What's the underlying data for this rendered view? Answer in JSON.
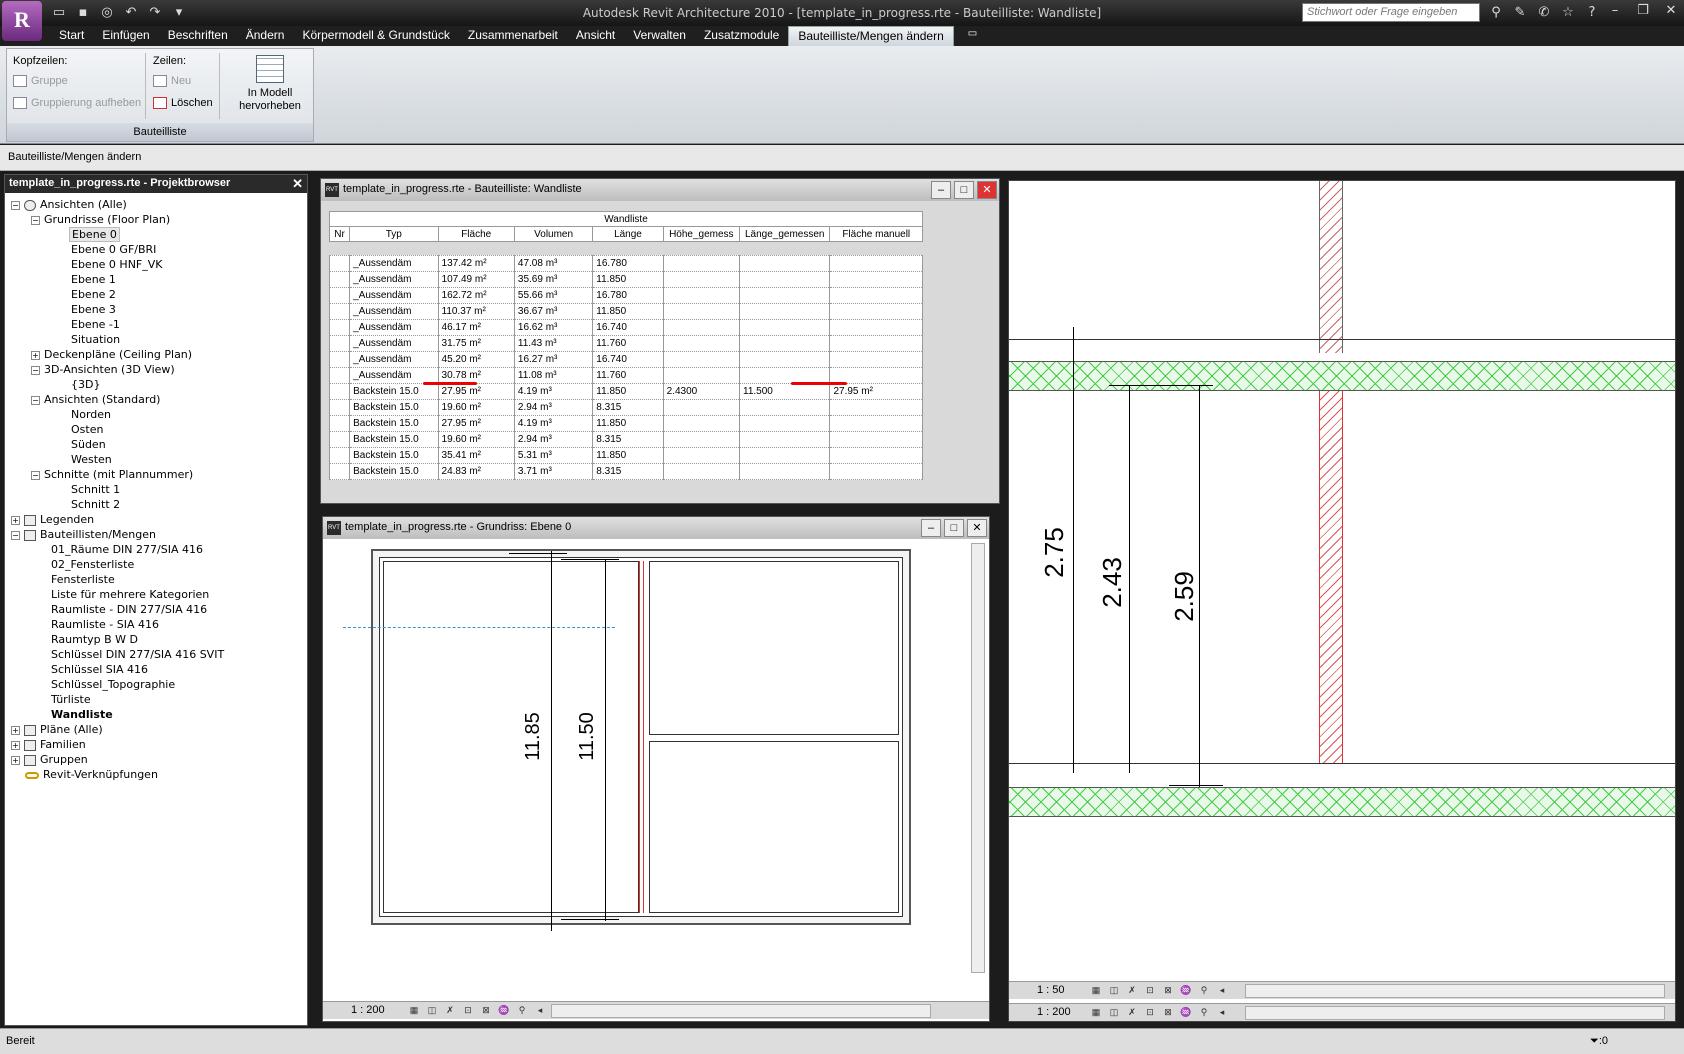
{
  "app": {
    "title": "Autodesk Revit Architecture 2010 - [template_in_progress.rte - Bauteilliste: Wandliste]",
    "logo": "R",
    "search_placeholder": "Stichwort oder Frage eingeben"
  },
  "menu": [
    "Start",
    "Einfügen",
    "Beschriften",
    "Ändern",
    "Körpermodell & Grundstück",
    "Zusammenarbeit",
    "Ansicht",
    "Verwalten",
    "Zusatzmodule",
    "Bauteilliste/Mengen ändern"
  ],
  "ribbon": {
    "kopfzeilen": "Kopfzeilen:",
    "gruppe": "Gruppe",
    "gruppierung": "Gruppierung aufheben",
    "zeilen": "Zeilen:",
    "neu": "Neu",
    "loeschen": "Löschen",
    "modell1": "In Modell",
    "modell2": "hervorheben",
    "panel": "Bauteilliste"
  },
  "context": "Bauteilliste/Mengen ändern",
  "browser": {
    "title": "template_in_progress.rte - Projektbrowser",
    "items": [
      "Ansichten (Alle)",
      "Grundrisse (Floor Plan)",
      "Ebene 0",
      "Ebene 0 GF/BRI",
      "Ebene 0 HNF_VK",
      "Ebene 1",
      "Ebene 2",
      "Ebene 3",
      "Ebene -1",
      "Situation",
      "Deckenpläne (Ceiling Plan)",
      "3D-Ansichten (3D View)",
      "{3D}",
      "Ansichten (Standard)",
      "Norden",
      "Osten",
      "Süden",
      "Westen",
      "Schnitte (mit Plannummer)",
      "Schnitt 1",
      "Schnitt 2",
      "Legenden",
      "Bauteillisten/Mengen",
      "01_Räume DIN 277/SIA 416",
      "02_Fensterliste",
      "Fensterliste",
      "Liste für mehrere Kategorien",
      "Raumliste - DIN 277/SIA 416",
      "Raumliste - SIA 416",
      "Raumtyp B W D",
      "Schlüssel DIN 277/SIA 416  SVIT",
      "Schlüssel SIA 416",
      "Schlüssel_Topographie",
      "Türliste",
      "Wandliste",
      "Pläne (Alle)",
      "Familien",
      "Gruppen",
      "Revit-Verknüpfungen"
    ]
  },
  "schedule": {
    "window_title": "template_in_progress.rte - Bauteilliste: Wandliste",
    "caption": "Wandliste",
    "headers": [
      "Nr",
      "Typ",
      "Fläche",
      "Volumen",
      "Länge",
      "Höhe_gemess",
      "Länge_gemessen",
      "Fläche manuell"
    ],
    "rows": [
      [
        "",
        "_Aussendäm",
        "137.42 m²",
        "47.08 m³",
        "16.780",
        "",
        "",
        ""
      ],
      [
        "",
        "_Aussendäm",
        "107.49 m²",
        "35.69 m³",
        "11.850",
        "",
        "",
        ""
      ],
      [
        "",
        "_Aussendäm",
        "162.72 m²",
        "55.66 m³",
        "16.780",
        "",
        "",
        ""
      ],
      [
        "",
        "_Aussendäm",
        "110.37 m²",
        "36.67 m³",
        "11.850",
        "",
        "",
        ""
      ],
      [
        "",
        "_Aussendäm",
        "46.17 m²",
        "16.62 m³",
        "16.740",
        "",
        "",
        ""
      ],
      [
        "",
        "_Aussendäm",
        "31.75 m²",
        "11.43 m³",
        "11.760",
        "",
        "",
        ""
      ],
      [
        "",
        "_Aussendäm",
        "45.20 m²",
        "16.27 m³",
        "16.740",
        "",
        "",
        ""
      ],
      [
        "",
        "_Aussendäm",
        "30.78 m²",
        "11.08 m³",
        "11.760",
        "",
        "",
        ""
      ],
      [
        "",
        "Backstein 15.0",
        "27.95 m²",
        "4.19 m³",
        "11.850",
        "2.4300",
        "11.500",
        "27.95 m²"
      ],
      [
        "",
        "Backstein 15.0",
        "19.60 m²",
        "2.94 m³",
        "8.315",
        "",
        "",
        ""
      ],
      [
        "",
        "Backstein 15.0",
        "27.95 m²",
        "4.19 m³",
        "11.850",
        "",
        "",
        ""
      ],
      [
        "",
        "Backstein 15.0",
        "19.60 m²",
        "2.94 m³",
        "8.315",
        "",
        "",
        ""
      ],
      [
        "",
        "Backstein 15.0",
        "35.41 m²",
        "5.31 m³",
        "11.850",
        "",
        "",
        ""
      ],
      [
        "",
        "Backstein 15.0",
        "24.83 m²",
        "3.71 m³",
        "8.315",
        "",
        "",
        ""
      ]
    ]
  },
  "plan": {
    "window_title": "template_in_progress.rte - Grundriss: Ebene 0",
    "dim1": "11.85",
    "dim2": "11.50",
    "scale": "1 : 200"
  },
  "section": {
    "dim1": "2.75",
    "dim2": "2.43",
    "dim3": "2.59",
    "scale1": "1 : 50",
    "scale2": "1 : 200"
  },
  "status": {
    "left": "Bereit",
    "right": ":0"
  }
}
